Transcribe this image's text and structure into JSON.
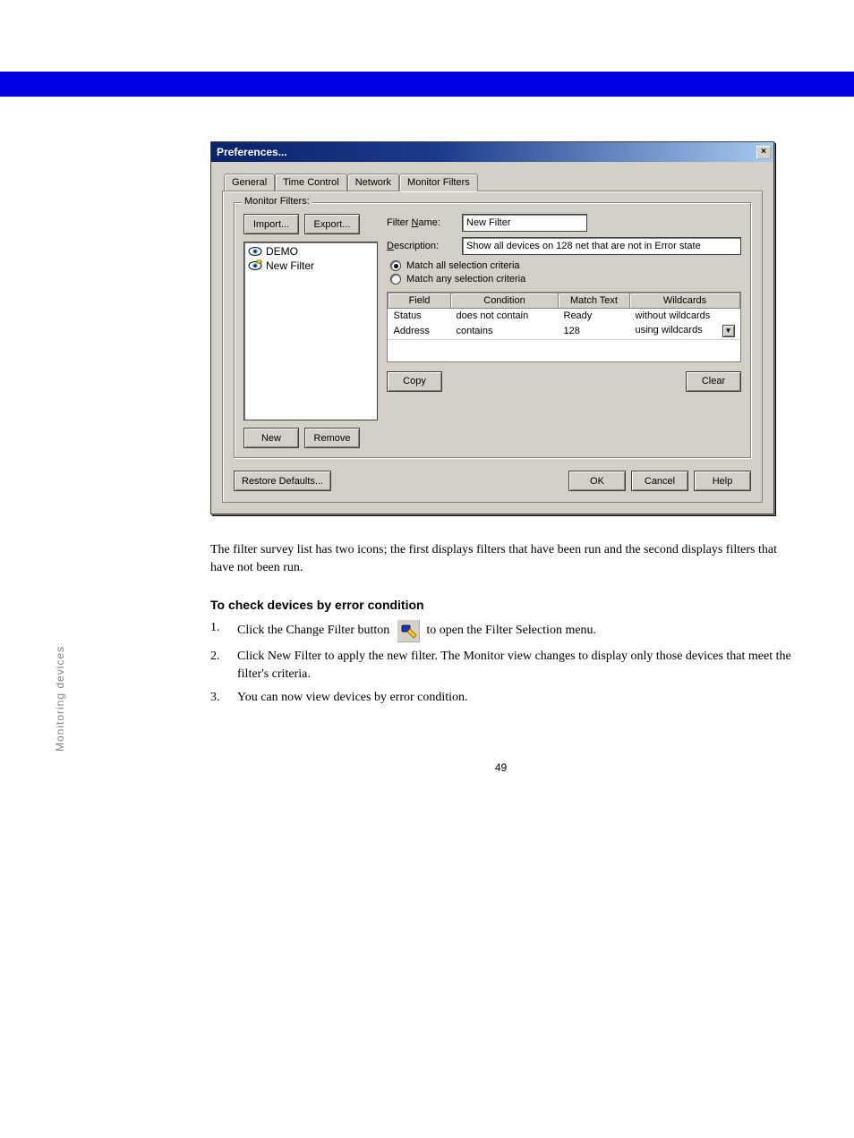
{
  "page_number": "49",
  "section_header": "Monitoring devices",
  "survey_text": "The filter survey list has two icons; the first displays filters that have been run and the second displays filters that have not been run.",
  "proc_heading": "To check devices by error condition",
  "steps": {
    "s1_num": "1.",
    "s1_text": "Click the Change Filter button ",
    "s1_tail": " to open the Filter Selection menu.",
    "s2_num": "2.",
    "s2_text": "Click New Filter to apply the new filter. The Monitor view changes to display only those devices that meet the filter's criteria.",
    "s3_num": "3.",
    "s3_text": "You can now view devices by error condition."
  },
  "dialog": {
    "title": "Preferences...",
    "close": "×",
    "tabs": [
      "General",
      "Time Control",
      "Network",
      "Monitor Filters"
    ],
    "active_tab": 3,
    "group_label": "Monitor Filters:",
    "buttons": {
      "import": "Import...",
      "export": "Export...",
      "new": "New",
      "remove": "Remove",
      "copy": "Copy",
      "clear": "Clear",
      "restore": "Restore Defaults...",
      "ok": "OK",
      "cancel": "Cancel",
      "help": "Help"
    },
    "filters": [
      "DEMO",
      "New Filter"
    ],
    "filter_name_label_pre": "Filter ",
    "filter_name_label_u": "N",
    "filter_name_label_post": "ame:",
    "filter_name_value": "New Filter",
    "description_label_u": "D",
    "description_label_post": "escription:",
    "description_value": "Show all devices on 128 net that are not in Error state",
    "radio_all": "Match all selection criteria",
    "radio_any": "Match any selection criteria",
    "grid": {
      "headers": [
        "Field",
        "Condition",
        "Match Text",
        "Wildcards"
      ],
      "rows": [
        {
          "field": "Status",
          "condition": "does not contain",
          "match": "Ready",
          "wild": "without wildcards"
        },
        {
          "field": "Address",
          "condition": "contains",
          "match": "128",
          "wild": "using wildcards"
        }
      ]
    }
  },
  "icons": {
    "eye_normal": "eye-icon",
    "eye_flag": "eye-flag-icon",
    "change_filter": "change-filter-icon",
    "dropdown": "▼"
  }
}
